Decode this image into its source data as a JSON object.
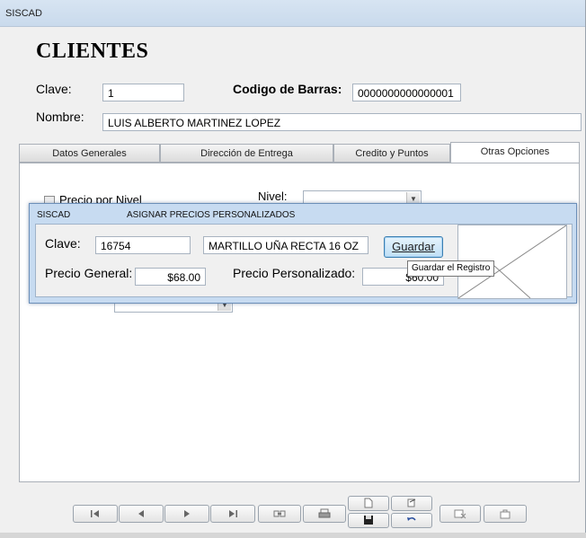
{
  "window": {
    "title": "SISCAD"
  },
  "form": {
    "heading": "CLIENTES"
  },
  "cliente": {
    "clave_label": "Clave:",
    "clave_value": "1",
    "barcode_label": "Codigo de Barras:",
    "barcode_value": "0000000000000001",
    "nombre_label": "Nombre:",
    "nombre_value": "LUIS ALBERTO MARTINEZ LOPEZ"
  },
  "tabs": [
    {
      "label": "Datos Generales"
    },
    {
      "label": "Dirección de Entrega"
    },
    {
      "label": "Credito y Puntos"
    },
    {
      "label": "Otras Opciones"
    }
  ],
  "otras_opciones": {
    "precio_nivel_label": "Precio por Nivel",
    "nivel_label": "Nivel:"
  },
  "popup": {
    "app": "SISCAD",
    "title": "ASIGNAR PRECIOS PERSONALIZADOS",
    "clave_label": "Clave:",
    "clave_value": "16754",
    "descripcion_value": "MARTILLO UÑA RECTA 16 OZ",
    "guardar_label": "Guardar",
    "precio_general_label": "Precio General:",
    "precio_general_value": "$68.00",
    "precio_personalizado_label": "Precio Personalizado:",
    "precio_personalizado_value": "$60.00",
    "tooltip": "Guardar el Registro"
  },
  "navigation": {
    "icons": [
      "first-record-icon",
      "previous-record-icon",
      "next-record-icon",
      "last-record-icon",
      "search-icon",
      "print-icon",
      "new-record-icon",
      "edit-icon",
      "save-icon",
      "undo-icon",
      "delete-icon",
      "exit-icon"
    ]
  }
}
